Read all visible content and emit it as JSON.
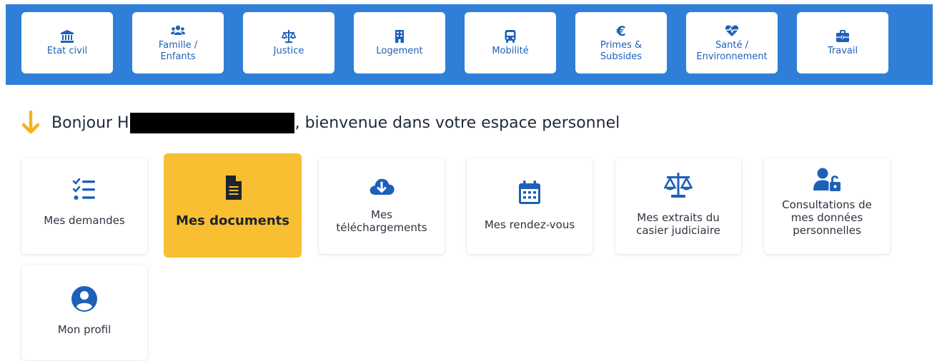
{
  "topnav": [
    {
      "label": "Etat civil",
      "icon": "bank-icon"
    },
    {
      "label": "Famille /\nEnfants",
      "icon": "users-icon"
    },
    {
      "label": "Justice",
      "icon": "scale-icon"
    },
    {
      "label": "Logement",
      "icon": "building-icon"
    },
    {
      "label": "Mobilité",
      "icon": "bus-icon"
    },
    {
      "label": "Primes &\nSubsides",
      "icon": "euro-icon"
    },
    {
      "label": "Santé /\nEnvironnement",
      "icon": "heartbeat-icon"
    },
    {
      "label": "Travail",
      "icon": "briefcase-icon"
    }
  ],
  "greeting": {
    "prefix": "Bonjour H",
    "suffix": ", bienvenue dans votre espace personnel"
  },
  "cards": [
    {
      "label": "Mes demandes",
      "icon": "checklist-icon"
    },
    {
      "label": "Mes documents",
      "icon": "document-icon",
      "active": true
    },
    {
      "label": "Mes\ntéléchargements",
      "icon": "cloud-download-icon"
    },
    {
      "label": "Mes rendez-vous",
      "icon": "calendar-icon"
    },
    {
      "label": "Mes extraits du\ncasier judiciaire",
      "icon": "scale-icon"
    },
    {
      "label": "Consultations de\nmes données\npersonnelles",
      "icon": "user-lock-icon"
    },
    {
      "label": "Mon profil",
      "icon": "user-circle-icon"
    }
  ],
  "colors": {
    "topbar": "#2f7fd8",
    "icon": "#1e60b8",
    "active_card": "#f7bf31",
    "arrow": "#f5b41a"
  }
}
